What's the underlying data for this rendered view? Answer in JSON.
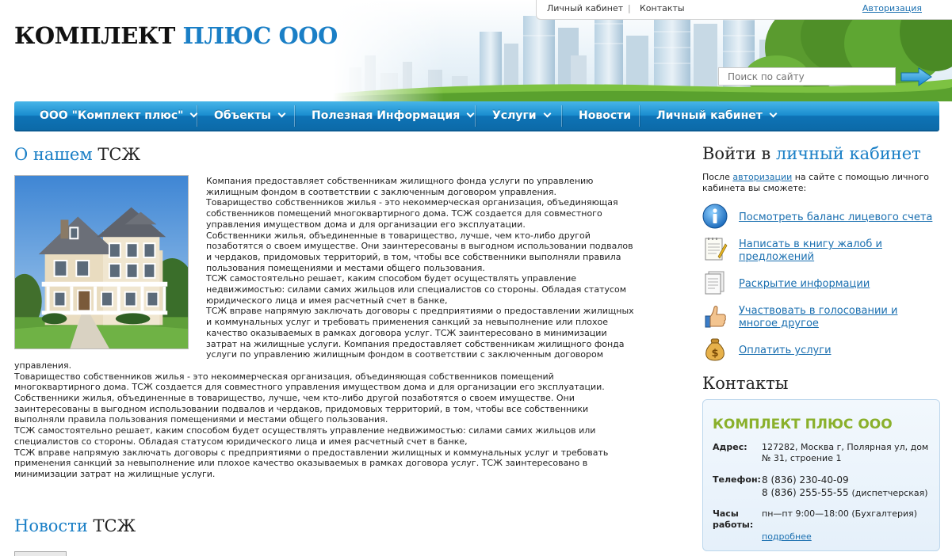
{
  "header": {
    "logo_part1": "КОМПЛЕКТ",
    "logo_part2": "ПЛЮС ООО",
    "top_links": {
      "cabinet": "Личный кабинет",
      "separator": "|",
      "contacts": "Контакты",
      "auth": "Авторизация"
    },
    "search_placeholder": "Поиск по сайту"
  },
  "nav": {
    "items": [
      {
        "label": "ООО \"Комплект плюс\"",
        "has_dropdown": true
      },
      {
        "label": "Объекты",
        "has_dropdown": true
      },
      {
        "label": "Полезная Информация",
        "has_dropdown": true
      },
      {
        "label": "Услуги",
        "has_dropdown": true
      },
      {
        "label": "Новости",
        "has_dropdown": false
      },
      {
        "label": "Личный кабинет",
        "has_dropdown": true
      }
    ]
  },
  "about": {
    "title_blue": "О нашем",
    "title_dark": "ТСЖ",
    "paragraphs": [
      "Компания предоставляет собственникам жилищного фонда услуги по управлению жилищным фондом в соответствии с заключенным договором управления.",
      "Товарищество собственников жилья - это некоммерческая организация, объединяющая собственников помещений многоквартирного дома. ТСЖ создается для совместного управления имуществом дома и для организации его эксплуатации.",
      "Собственники жилья, объединенные в товарищество, лучше, чем кто-либо другой позаботятся о своем имуществе. Они заинтересованы в выгодном использовании подвалов и чердаков, придомовых территорий, в том, чтобы все собственники выполняли правила пользования помещениями и местами общего пользования.",
      "ТСЖ самостоятельно решает, каким способом будет осуществлять управление недвижимостью: силами самих жильцов или специалистов со стороны. Обладая статусом юридического лица и имея расчетный счет в банке,",
      "ТСЖ вправе напрямую заключать договоры с предприятиями о предоставлении жилищных и коммунальных услуг и требовать применения санкций за невыполнение или плохое качество оказываемых в рамках договора услуг. ТСЖ заинтересовано в минимизации затрат на жилищные услуги. Компания предоставляет собственникам жилищного фонда услуги по управлению жилищным фондом в соответствии с заключенным договором управления.",
      "Товарищество собственников жилья - это некоммерческая организация, объединяющая собственников помещений многоквартирного дома. ТСЖ создается для совместного управления имуществом дома и для организации его эксплуатации.",
      "Собственники жилья, объединенные в товарищество, лучше, чем кто-либо другой позаботятся о своем имуществе. Они заинтересованы в выгодном использовании подвалов и чердаков, придомовых территорий, в том, чтобы все собственники выполняли правила пользования помещениями и местами общего пользования.",
      "ТСЖ самостоятельно решает, каким способом будет осуществлять управление недвижимостью: силами самих жильцов или специалистов со стороны. Обладая статусом юридического лица и имея расчетный счет в банке,",
      "ТСЖ вправе напрямую заключать договоры с предприятиями о предоставлении жилищных и коммунальных услуг и требовать применения санкций за невыполнение или плохое качество оказываемых в рамках договора услуг. ТСЖ заинтересовано в минимизации затрат на жилищные услуги."
    ]
  },
  "news": {
    "title_blue": "Новости",
    "title_dark": "ТСЖ"
  },
  "login": {
    "title_dark": "Войти в",
    "title_blue": "личный кабинет",
    "intro_before": "После ",
    "intro_link": "авторизации",
    "intro_after": " на сайте с помощью личного кабинета вы сможете:",
    "links": [
      {
        "label": "Посмотреть баланс лицевого счета",
        "icon": "info-icon"
      },
      {
        "label": "Написать в книгу жалоб и предложений",
        "icon": "notepad-icon"
      },
      {
        "label": "Раскрытие информации",
        "icon": "document-icon"
      },
      {
        "label": "Участвовать в голосовании и многое другое",
        "icon": "thumbs-up-icon"
      },
      {
        "label": "Оплатить услуги",
        "icon": "money-bag-icon"
      }
    ]
  },
  "contacts": {
    "title": "Контакты",
    "company": "КОМПЛЕКТ ПЛЮС ООО",
    "address_label": "Адрес:",
    "address": "127282, Москва г, Полярная ул, дом № 31, строение 1",
    "phone_label": "Телефон:",
    "phone1": "8 (836) 230-40-09",
    "phone2": "8 (836) 255-55-55",
    "phone2_note": "(диспетчерская)",
    "hours_label": "Часы работы:",
    "hours": "пн—пт 9:00—18:00 (Бухгалтерия)",
    "more": "подробнее"
  },
  "colors": {
    "accent_blue": "#1a7fc6",
    "link_blue": "#1a6fb0",
    "company_green": "#8ab02b",
    "nav_blue": "#1b8ed0"
  }
}
